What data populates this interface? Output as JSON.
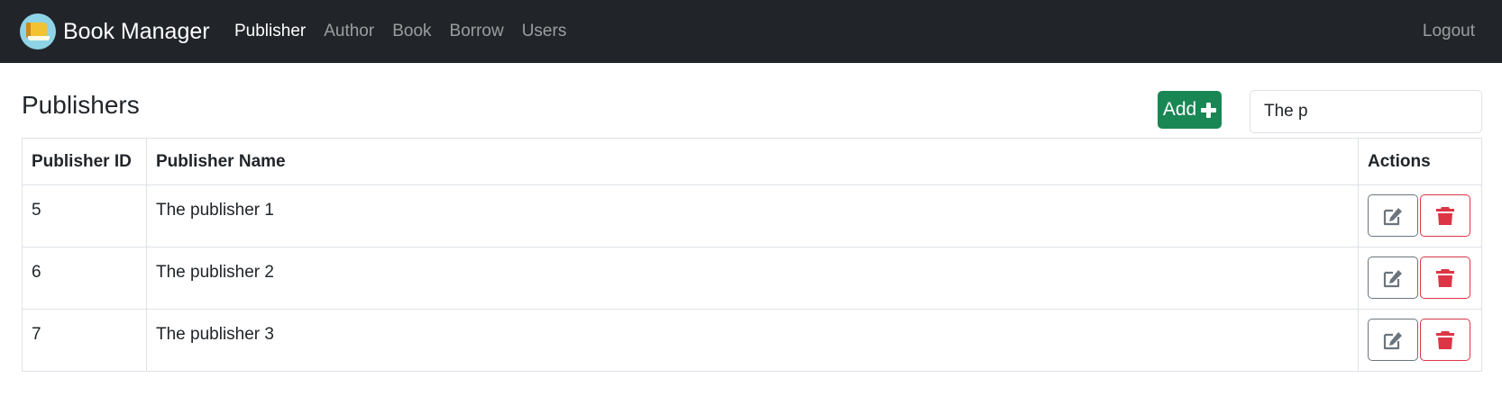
{
  "app": {
    "brand": "Book Manager",
    "nav": [
      {
        "label": "Publisher",
        "active": true
      },
      {
        "label": "Author",
        "active": false
      },
      {
        "label": "Book",
        "active": false
      },
      {
        "label": "Borrow",
        "active": false
      },
      {
        "label": "Users",
        "active": false
      }
    ],
    "logout_label": "Logout"
  },
  "page": {
    "title": "Publishers",
    "add_label": "Add",
    "search_value": "The p"
  },
  "table": {
    "headers": [
      "Publisher ID",
      "Publisher Name",
      "Actions"
    ],
    "rows": [
      {
        "id": "5",
        "name": "The publisher 1"
      },
      {
        "id": "6",
        "name": "The publisher 2"
      },
      {
        "id": "7",
        "name": "The publisher 3"
      }
    ]
  },
  "icons": {
    "logo": "book-logo-icon",
    "add": "plus-icon",
    "edit": "edit-icon",
    "delete": "trash-icon"
  },
  "colors": {
    "navbar": "#212529",
    "add_button": "#198754",
    "edit_border": "#6c757d",
    "delete": "#dc3545"
  }
}
